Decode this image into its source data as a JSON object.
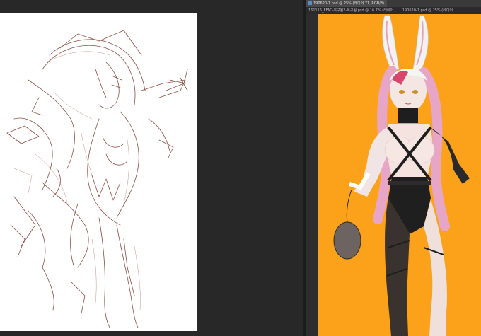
{
  "tabs_row_1": [
    {
      "label": "190620-1.psd @ 25% (레이어 71, RGB/8)",
      "active": true
    }
  ],
  "tabs_row_2": [
    {
      "label": "161116_FFAC-복구됨2-복구됨.psd @ 16.7% (레이어...",
      "active": false
    },
    {
      "label": "190620-1.psd @ 25% (레이어...",
      "active": false
    }
  ],
  "colors": {
    "workspace_bg": "#282828",
    "left_canvas": "#ffffff",
    "right_canvas": "#fba21a",
    "sketch_stroke": "#7a2e22"
  }
}
